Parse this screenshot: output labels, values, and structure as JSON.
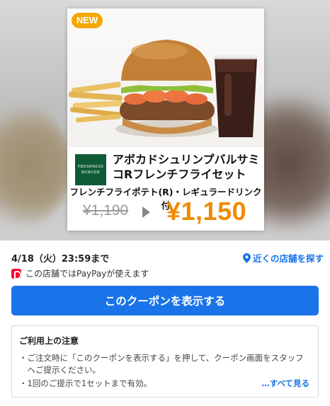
{
  "coupon": {
    "badge": "NEW",
    "brand": "FRESHNESS BURGER",
    "product_name": "アボカドシュリンプバルサミコRフレンチフライセット",
    "subtitle": "フレンチフライポテト(R)・レギュラードリンク付",
    "old_price": "¥1,190",
    "new_price": "¥1,150"
  },
  "info": {
    "deadline": "4/18（火）23:59まで",
    "near_stores": "近くの店舗を探す",
    "paypay_note": "この店舗ではPayPayが使えます"
  },
  "cta": {
    "label": "このクーポンを表示する"
  },
  "notice": {
    "title": "ご利用上の注意",
    "line1": "・ご注文時に「このクーポンを表示する」を押して、クーポン画面をスタッフ",
    "line2": "　へご提示ください。",
    "line3": "・1回のご提示で1セットまで有効。",
    "see_all": "…すべて見る"
  },
  "colors": {
    "accent_blue": "#1a73e8",
    "price_orange": "#f08a00",
    "badge_yellow": "#f4a700",
    "brand_green": "#0e5a36",
    "paypay_red": "#ff0033"
  },
  "icons": [
    "location-pin-icon",
    "paypay-icon",
    "arrow-right-icon"
  ]
}
